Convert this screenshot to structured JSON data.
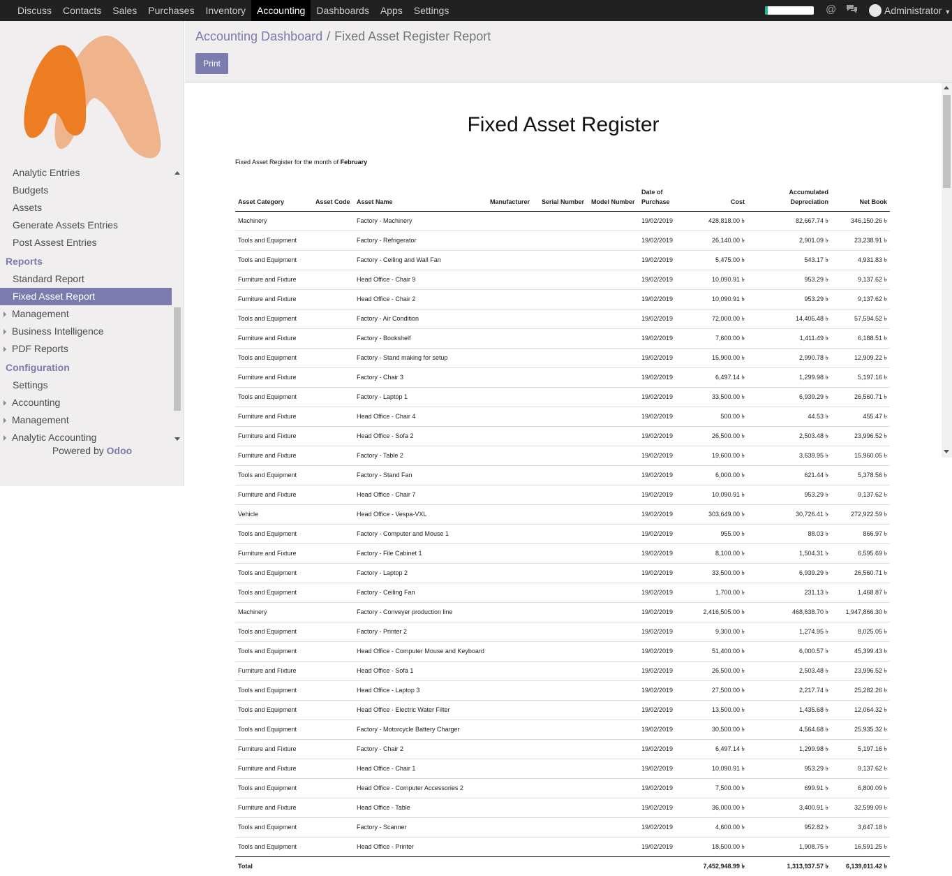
{
  "topbar": {
    "menu": [
      "Discuss",
      "Contacts",
      "Sales",
      "Purchases",
      "Inventory",
      "Accounting",
      "Dashboards",
      "Apps",
      "Settings"
    ],
    "active": "Accounting",
    "user": "Administrator",
    "progress": 0.06,
    "icons": [
      "at-icon",
      "chat-icon",
      "caret-down-icon"
    ]
  },
  "sidebar": {
    "items": [
      {
        "label": "Analytic Entries",
        "type": "item"
      },
      {
        "label": "Budgets",
        "type": "item"
      },
      {
        "label": "Assets",
        "type": "item"
      },
      {
        "label": "Generate Assets Entries",
        "type": "item"
      },
      {
        "label": "Post Assest Entries",
        "type": "item"
      },
      {
        "label": "Reports",
        "type": "head"
      },
      {
        "label": "Standard Report",
        "type": "item"
      },
      {
        "label": "Fixed Asset Report",
        "type": "active"
      },
      {
        "label": "Management",
        "type": "caret"
      },
      {
        "label": "Business Intelligence",
        "type": "caret"
      },
      {
        "label": "PDF Reports",
        "type": "caret"
      },
      {
        "label": "Configuration",
        "type": "head"
      },
      {
        "label": "Settings",
        "type": "item"
      },
      {
        "label": "Accounting",
        "type": "caret"
      },
      {
        "label": "Management",
        "type": "caret"
      },
      {
        "label": "Analytic Accounting",
        "type": "caret"
      }
    ],
    "powered_prefix": "Powered by ",
    "powered_brand": "Odoo"
  },
  "breadcrumb": {
    "parent": "Accounting Dashboard",
    "separator": "/",
    "current": "Fixed Asset Register Report"
  },
  "print_label": "Print",
  "report": {
    "title": "Fixed Asset Register",
    "subtitle_prefix": "Fixed Asset Register for the month of ",
    "subtitle_month": "February",
    "headers": [
      "Asset Category",
      "Asset Code",
      "Asset Name",
      "Manufacturer",
      "Serial Number",
      "Model Number",
      "Date of Purchase",
      "Cost",
      "Accumulated Depreciation",
      "Net Book"
    ],
    "rows": [
      [
        "Machinery",
        "",
        "Factory - Machinery",
        "",
        "",
        "",
        "19/02/2019",
        "428,818.00 ৳",
        "82,667.74 ৳",
        "346,150.26 ৳"
      ],
      [
        "Tools and Equipment",
        "",
        "Factory - Refrigerator",
        "",
        "",
        "",
        "19/02/2019",
        "26,140.00 ৳",
        "2,901.09 ৳",
        "23,238.91 ৳"
      ],
      [
        "Tools and Equipment",
        "",
        "Factory - Ceiling and Wall Fan",
        "",
        "",
        "",
        "19/02/2019",
        "5,475.00 ৳",
        "543.17 ৳",
        "4,931.83 ৳"
      ],
      [
        "Furniture and Fixture",
        "",
        "Head Office - Chair 9",
        "",
        "",
        "",
        "19/02/2019",
        "10,090.91 ৳",
        "953.29 ৳",
        "9,137.62 ৳"
      ],
      [
        "Furniture and Fixture",
        "",
        "Head Office - Chair 2",
        "",
        "",
        "",
        "19/02/2019",
        "10,090.91 ৳",
        "953.29 ৳",
        "9,137.62 ৳"
      ],
      [
        "Tools and Equipment",
        "",
        "Factory - Air Condition",
        "",
        "",
        "",
        "19/02/2019",
        "72,000.00 ৳",
        "14,405.48 ৳",
        "57,594.52 ৳"
      ],
      [
        "Furniture and Fixture",
        "",
        "Factory - Bookshelf",
        "",
        "",
        "",
        "19/02/2019",
        "7,600.00 ৳",
        "1,411.49 ৳",
        "6,188.51 ৳"
      ],
      [
        "Tools and Equipment",
        "",
        "Factory - Stand making for setup",
        "",
        "",
        "",
        "19/02/2019",
        "15,900.00 ৳",
        "2,990.78 ৳",
        "12,909.22 ৳"
      ],
      [
        "Furniture and Fixture",
        "",
        "Factory - Chair 3",
        "",
        "",
        "",
        "19/02/2019",
        "6,497.14 ৳",
        "1,299.98 ৳",
        "5,197.16 ৳"
      ],
      [
        "Tools and Equipment",
        "",
        "Factory - Laptop 1",
        "",
        "",
        "",
        "19/02/2019",
        "33,500.00 ৳",
        "6,939.29 ৳",
        "26,560.71 ৳"
      ],
      [
        "Furniture and Fixture",
        "",
        "Head Office - Chair 4",
        "",
        "",
        "",
        "19/02/2019",
        "500.00 ৳",
        "44.53 ৳",
        "455.47 ৳"
      ],
      [
        "Furniture and Fixture",
        "",
        "Head Office - Sofa 2",
        "",
        "",
        "",
        "19/02/2019",
        "26,500.00 ৳",
        "2,503.48 ৳",
        "23,996.52 ৳"
      ],
      [
        "Furniture and Fixture",
        "",
        "Factory - Table 2",
        "",
        "",
        "",
        "19/02/2019",
        "19,600.00 ৳",
        "3,639.95 ৳",
        "15,960.05 ৳"
      ],
      [
        "Tools and Equipment",
        "",
        "Factory - Stand Fan",
        "",
        "",
        "",
        "19/02/2019",
        "6,000.00 ৳",
        "621.44 ৳",
        "5,378.56 ৳"
      ],
      [
        "Furniture and Fixture",
        "",
        "Head Office - Chair 7",
        "",
        "",
        "",
        "19/02/2019",
        "10,090.91 ৳",
        "953.29 ৳",
        "9,137.62 ৳"
      ],
      [
        "Vehicle",
        "",
        "Head Office - Vespa-VXL",
        "",
        "",
        "",
        "19/02/2019",
        "303,649.00 ৳",
        "30,726.41 ৳",
        "272,922.59 ৳"
      ],
      [
        "Tools and Equipment",
        "",
        "Factory - Computer and Mouse 1",
        "",
        "",
        "",
        "19/02/2019",
        "955.00 ৳",
        "88.03 ৳",
        "866.97 ৳"
      ],
      [
        "Furniture and Fixture",
        "",
        "Factory - File Cabinet 1",
        "",
        "",
        "",
        "19/02/2019",
        "8,100.00 ৳",
        "1,504.31 ৳",
        "6,595.69 ৳"
      ],
      [
        "Tools and Equipment",
        "",
        "Factory - Laptop 2",
        "",
        "",
        "",
        "19/02/2019",
        "33,500.00 ৳",
        "6,939.29 ৳",
        "26,560.71 ৳"
      ],
      [
        "Tools and Equipment",
        "",
        "Factory - Ceiling Fan",
        "",
        "",
        "",
        "19/02/2019",
        "1,700.00 ৳",
        "231.13 ৳",
        "1,468.87 ৳"
      ],
      [
        "Machinery",
        "",
        "Factory - Conveyer production line",
        "",
        "",
        "",
        "19/02/2019",
        "2,416,505.00 ৳",
        "468,638.70 ৳",
        "1,947,866.30 ৳"
      ],
      [
        "Tools and Equipment",
        "",
        "Factory - Printer 2",
        "",
        "",
        "",
        "19/02/2019",
        "9,300.00 ৳",
        "1,274.95 ৳",
        "8,025.05 ৳"
      ],
      [
        "Tools and Equipment",
        "",
        "Head Office - Computer Mouse and Keyboard",
        "",
        "",
        "",
        "19/02/2019",
        "51,400.00 ৳",
        "6,000.57 ৳",
        "45,399.43 ৳"
      ],
      [
        "Furniture and Fixture",
        "",
        "Head Office - Sofa 1",
        "",
        "",
        "",
        "19/02/2019",
        "26,500.00 ৳",
        "2,503.48 ৳",
        "23,996.52 ৳"
      ],
      [
        "Tools and Equipment",
        "",
        "Head Office - Laptop 3",
        "",
        "",
        "",
        "19/02/2019",
        "27,500.00 ৳",
        "2,217.74 ৳",
        "25,282.26 ৳"
      ],
      [
        "Tools and Equipment",
        "",
        "Head Office - Electric Water Filter",
        "",
        "",
        "",
        "19/02/2019",
        "13,500.00 ৳",
        "1,435.68 ৳",
        "12,064.32 ৳"
      ],
      [
        "Tools and Equipment",
        "",
        "Factory - Motorcycle Battery Charger",
        "",
        "",
        "",
        "19/02/2019",
        "30,500.00 ৳",
        "4,564.68 ৳",
        "25,935.32 ৳"
      ],
      [
        "Furniture and Fixture",
        "",
        "Factory - Chair 2",
        "",
        "",
        "",
        "19/02/2019",
        "6,497.14 ৳",
        "1,299.98 ৳",
        "5,197.16 ৳"
      ],
      [
        "Furniture and Fixture",
        "",
        "Head Office - Chair 1",
        "",
        "",
        "",
        "19/02/2019",
        "10,090.91 ৳",
        "953.29 ৳",
        "9,137.62 ৳"
      ],
      [
        "Tools and Equipment",
        "",
        "Head Office - Computer Accessories 2",
        "",
        "",
        "",
        "19/02/2019",
        "7,500.00 ৳",
        "699.91 ৳",
        "6,800.09 ৳"
      ],
      [
        "Furniture and Fixture",
        "",
        "Head Office - Table",
        "",
        "",
        "",
        "19/02/2019",
        "36,000.00 ৳",
        "3,400.91 ৳",
        "32,599.09 ৳"
      ],
      [
        "Tools and Equipment",
        "",
        "Factory - Scanner",
        "",
        "",
        "",
        "19/02/2019",
        "4,600.00 ৳",
        "952.82 ৳",
        "3,647.18 ৳"
      ],
      [
        "Tools and Equipment",
        "",
        "Head Office - Printer",
        "",
        "",
        "",
        "19/02/2019",
        "18,500.00 ৳",
        "1,908.75 ৳",
        "16,591.25 ৳"
      ]
    ],
    "total_label": "Total",
    "total_cost": "7,452,948.99 ৳",
    "total_depreciation": "1,313,937.57 ৳",
    "total_net": "6,139,011.42 ৳"
  }
}
